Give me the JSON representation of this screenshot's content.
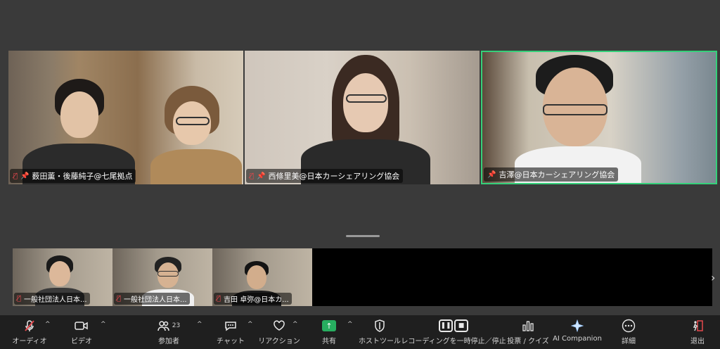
{
  "participants_main": [
    {
      "name": "薮田薫・後藤純子@七尾拠点",
      "muted": true,
      "pinned": true
    },
    {
      "name": "西條里美@日本カーシェアリング協会",
      "muted": true,
      "pinned": true
    },
    {
      "name": "吉澤@日本カーシェアリング協会",
      "muted": false,
      "pinned": true,
      "active_speaker": true
    }
  ],
  "participants_strip": [
    {
      "name": "一般社団法人日本...",
      "muted": true
    },
    {
      "name": "一般社団法人日本...",
      "muted": true
    },
    {
      "name": "吉田 卓弥@日本カ...",
      "muted": true
    }
  ],
  "toolbar": {
    "audio": {
      "label": "オーディオ",
      "icon": "mic-muted-icon"
    },
    "video": {
      "label": "ビデオ",
      "icon": "video-icon"
    },
    "participants": {
      "label": "参加者",
      "count": "23",
      "icon": "participants-icon"
    },
    "chat": {
      "label": "チャット",
      "icon": "chat-icon"
    },
    "reactions": {
      "label": "リアクション",
      "icon": "heart-icon"
    },
    "share": {
      "label": "共有",
      "icon": "share-up-arrow-icon"
    },
    "host_tools": {
      "label": "ホストツール",
      "icon": "shield-icon"
    },
    "recording": {
      "label": "レコーディングを一時停止／停止",
      "icon": "pause-stop-icon"
    },
    "polls": {
      "label": "投票 / クイズ",
      "icon": "bar-chart-icon"
    },
    "ai_companion": {
      "label": "AI Companion",
      "icon": "sparkle-icon"
    },
    "more": {
      "label": "詳細",
      "icon": "more-dots-icon"
    },
    "leave": {
      "label": "退出",
      "icon": "leave-icon"
    }
  },
  "colors": {
    "background": "#3a3a3a",
    "toolbar": "#1f1f1f",
    "active_border": "#35d07a",
    "mute_red": "#e5484d",
    "share_green": "#27ae60"
  }
}
